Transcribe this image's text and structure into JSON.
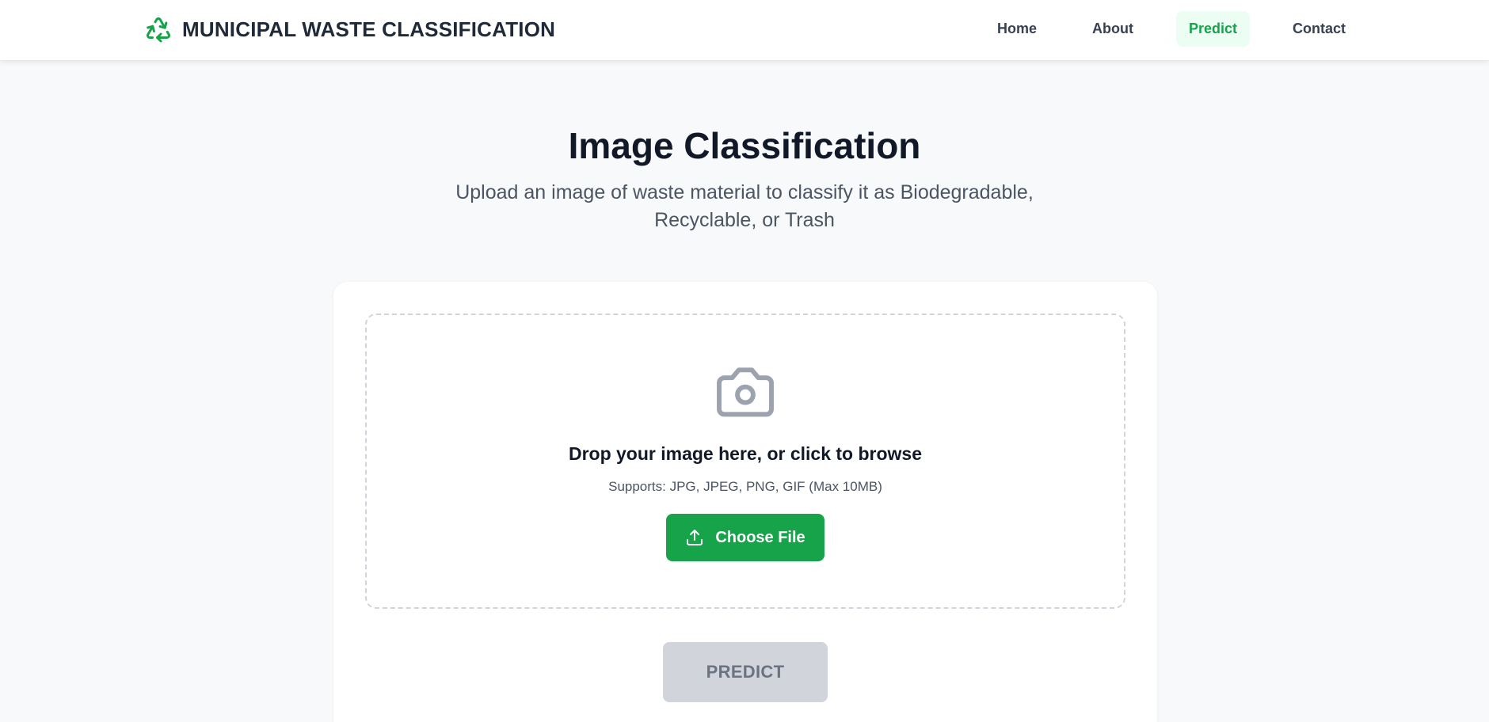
{
  "header": {
    "brand_icon": "recycle-icon",
    "brand_title": "MUNICIPAL WASTE CLASSIFICATION",
    "nav": [
      {
        "label": "Home"
      },
      {
        "label": "About"
      },
      {
        "label": "Predict",
        "active": true
      },
      {
        "label": "Contact"
      }
    ]
  },
  "hero": {
    "title": "Image Classification",
    "subtitle": "Upload an image of waste material to classify it as Biodegradable, Recyclable, or Trash"
  },
  "upload": {
    "icon": "camera-icon",
    "title": "Drop your image here, or click to browse",
    "hint": "Supports: JPG, JPEG, PNG, GIF (Max 10MB)",
    "button_icon": "upload-icon",
    "button_label": "Choose File"
  },
  "actions": {
    "predict_label": "PREDICT",
    "predict_disabled": true
  },
  "colors": {
    "accent": "#16a34a",
    "accent_light": "#ecfdf3",
    "disabled_bg": "#d1d5db",
    "disabled_text": "#6b7280",
    "page_bg": "#f8f9fa"
  }
}
